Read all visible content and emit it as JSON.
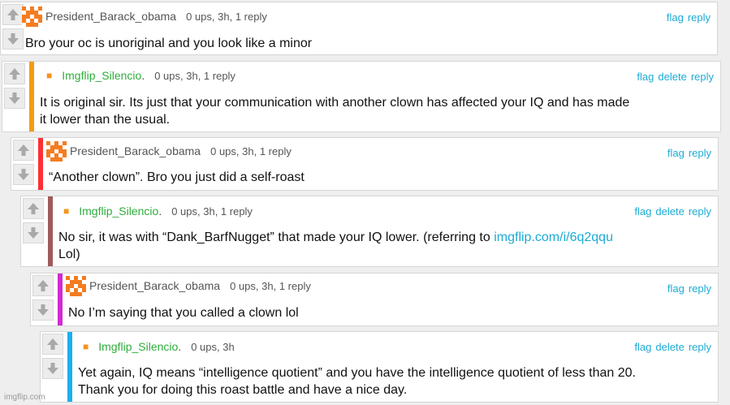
{
  "comments": [
    {
      "user": "President_Barack_obama",
      "meta": "0 ups, 3h, 1 reply",
      "actions": [
        "flag",
        "reply"
      ],
      "text": "Bro your oc is unoriginal and you look like a minor",
      "accent_color": "",
      "user_style": "orange-checker-avatar"
    },
    {
      "user": "Imgflip_Silencio",
      "user_suffix": ".",
      "meta": "0 ups, 3h, 1 reply",
      "actions": [
        "flag",
        "delete",
        "reply"
      ],
      "text_line1": "It is original sir. Its just that your communication with another clown has affected your IQ and has made",
      "text_line2": "it lower than the usual.",
      "accent_color": "#f39c12"
    },
    {
      "user": "President_Barack_obama",
      "meta": "0 ups, 3h, 1 reply",
      "actions": [
        "flag",
        "reply"
      ],
      "text": "“Another clown”. Bro you just did a self-roast",
      "accent_color": "#ff2f35"
    },
    {
      "user": "Imgflip_Silencio",
      "user_suffix": ".",
      "meta": "0 ups, 3h, 1 reply",
      "actions": [
        "flag",
        "delete",
        "reply"
      ],
      "text_line1_pre": "No sir, it was with “Dank_BarfNugget” that made your IQ lower. (referring to ",
      "text_line1_link": "imgflip.com/i/6q2qqu",
      "text_line2": "Lol)",
      "accent_color": "#a05a5a"
    },
    {
      "user": "President_Barack_obama",
      "meta": "0 ups, 3h, 1 reply",
      "actions": [
        "flag",
        "reply"
      ],
      "text": "No I’m saying that you called a clown lol",
      "accent_color": "#d12ad1"
    },
    {
      "user": "Imgflip_Silencio",
      "user_suffix": ".",
      "meta": "0 ups, 3h",
      "actions": [
        "flag",
        "delete",
        "reply"
      ],
      "text_line1": "Yet again, IQ means “intelligence quotient” and you have the intelligence quotient of less than 20.",
      "text_line2": "Thank you for doing this roast battle and have a nice day.",
      "accent_color": "#1ab0ef"
    }
  ],
  "watermark": "imgflip.com"
}
